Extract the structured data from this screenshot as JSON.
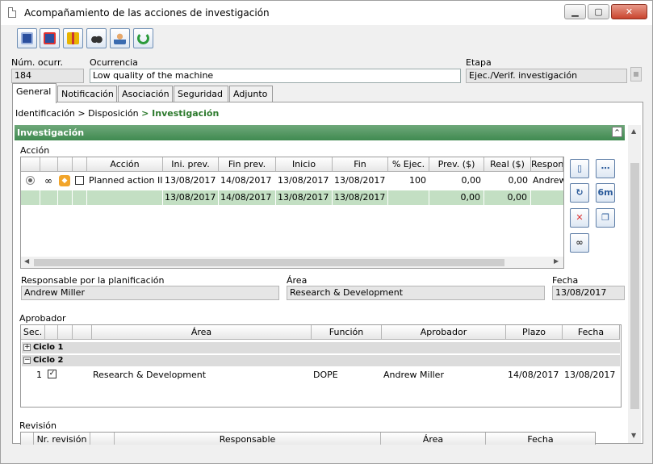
{
  "window": {
    "title": "Acompañamiento de las acciones de investigación"
  },
  "titlebar": {
    "minimize": "▁",
    "maximize": "▢",
    "close": "✕"
  },
  "header": {
    "num_label": "Núm. ocurr.",
    "num_value": "184",
    "occ_label": "Ocurrencia",
    "occ_value": "Low quality of the machine",
    "stage_label": "Etapa",
    "stage_value": "Ejec./Verif. investigación"
  },
  "tabs": [
    "General",
    "Notificación",
    "Asociación",
    "Seguridad",
    "Adjunto"
  ],
  "breadcrumb": {
    "a": "Identificación",
    "sep": ">",
    "b": "Disposición",
    "c": "> Investigación"
  },
  "section": {
    "title": "Investigación",
    "collapse": "^"
  },
  "accion": {
    "label": "Acción",
    "headers": [
      "Acción",
      "Ini. prev.",
      "Fin prev.",
      "Inicio",
      "Fin",
      "% Ejec.",
      "Prev. ($)",
      "Real ($)",
      "Respon"
    ],
    "row": [
      "Planned action II",
      "13/08/2017",
      "14/08/2017",
      "13/08/2017",
      "13/08/2017",
      "100",
      "0,00",
      "0,00",
      "Andrew"
    ],
    "total": [
      "13/08/2017",
      "14/08/2017",
      "13/08/2017",
      "13/08/2017",
      "0,00",
      "0,00"
    ]
  },
  "side_buttons": {
    "b6": "6m"
  },
  "plan": {
    "resp_label": "Responsable por la planificación",
    "resp_value": "Andrew Miller",
    "area_label": "Área",
    "area_value": "Research & Development",
    "fecha_label": "Fecha",
    "fecha_value": "13/08/2017"
  },
  "aprobador": {
    "label": "Aprobador",
    "headers": [
      "Sec.",
      "Área",
      "Función",
      "Aprobador",
      "Plazo",
      "Fecha"
    ],
    "cycle1": "Ciclo 1",
    "cycle2": "Ciclo 2",
    "cycle1_sign": "+",
    "cycle2_sign": "−",
    "row": {
      "sec": "1",
      "area": "Research & Development",
      "funcion": "DOPE",
      "aprobador": "Andrew Miller",
      "plazo": "14/08/2017",
      "fecha": "13/08/2017"
    }
  },
  "revision": {
    "label": "Revisión",
    "headers": [
      "Nr. revisión",
      "Responsable",
      "Área",
      "Fecha"
    ]
  }
}
